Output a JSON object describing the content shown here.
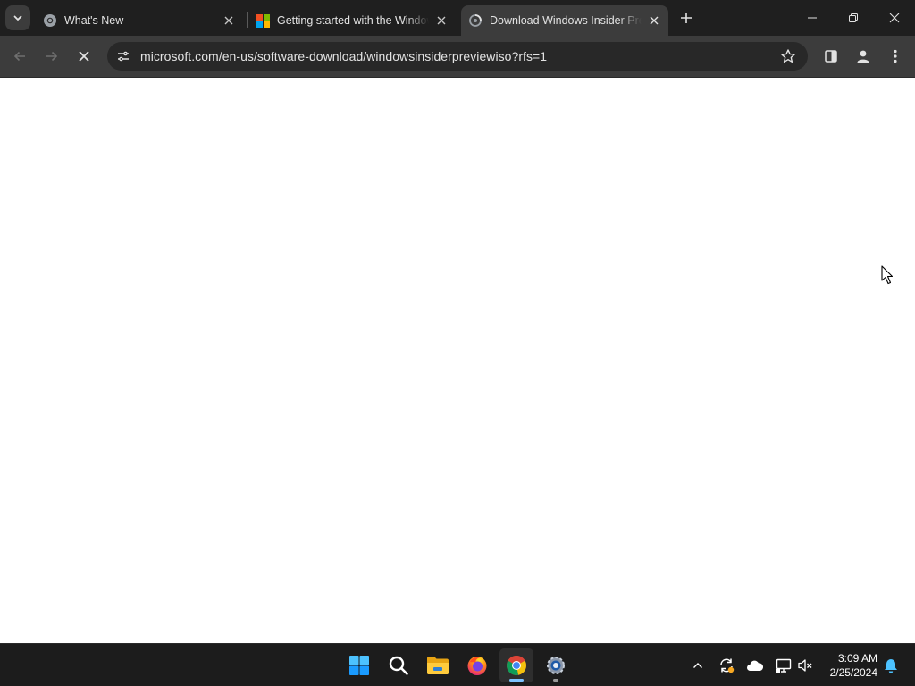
{
  "browser": {
    "tabs": [
      {
        "title": "What's New",
        "favicon": "chrome-icon",
        "active": false
      },
      {
        "title": "Getting started with the Windows Insider Program",
        "favicon": "microsoft-logo-icon",
        "active": false
      },
      {
        "title": "Download Windows Insider Preview ISO",
        "favicon": "loading-spinner-icon",
        "active": true
      }
    ],
    "address_bar": {
      "url": "microsoft.com/en-us/software-download/windowsinsiderpreviewiso?rfs=1"
    },
    "page_loading": true
  },
  "taskbar": {
    "pinned_apps": [
      "windows-start-icon",
      "search-icon",
      "file-explorer-icon",
      "firefox-icon",
      "chrome-icon",
      "settings-icon"
    ],
    "active_app": "chrome-icon",
    "tray_icons": [
      "show-hidden-icons-chevron",
      "sync-update-icon",
      "onedrive-cloud-icon",
      "network-icon",
      "volume-muted-icon",
      "notification-bell-icon"
    ],
    "clock": {
      "time": "3:09 AM",
      "date": "2/25/2024"
    }
  },
  "colors": {
    "titlebar": "#1f1f1f",
    "toolbar": "#3c3c3c",
    "omnibox": "#282828",
    "taskbar": "#1c1c1c",
    "chrome_indicator": "#7cc2ff"
  }
}
